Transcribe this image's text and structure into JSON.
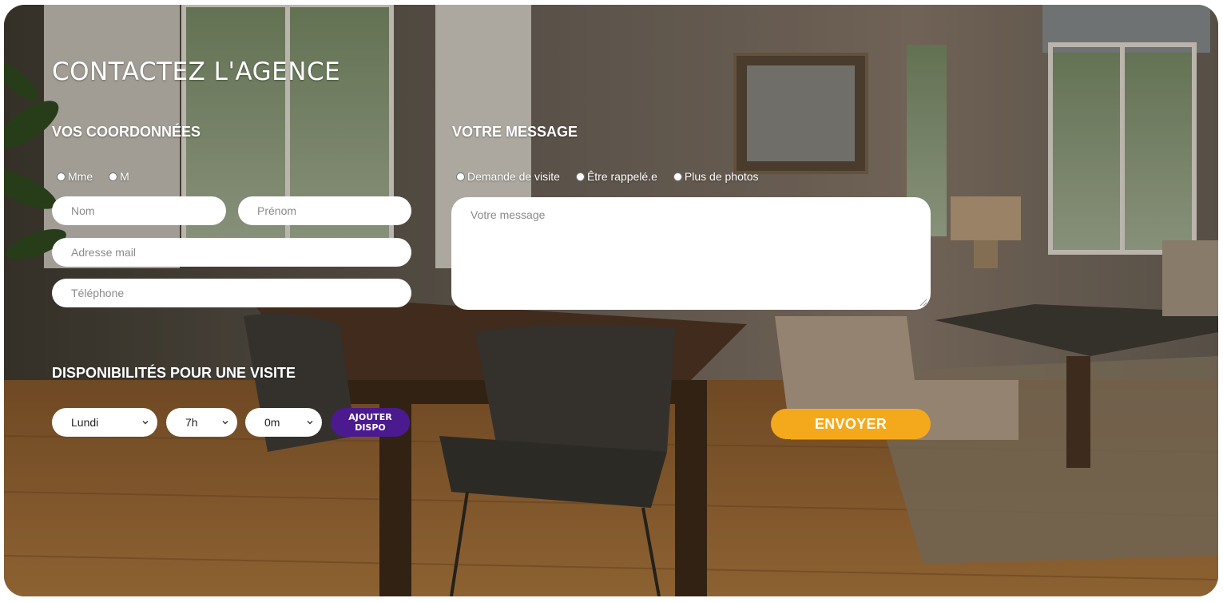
{
  "page": {
    "title": "CONTACTEZ L'AGENCE"
  },
  "coordonnees": {
    "heading": "VOS COORDONNÉES",
    "civility_options": [
      "Mme",
      "M"
    ],
    "nom_placeholder": "Nom",
    "prenom_placeholder": "Prénom",
    "email_placeholder": "Adresse mail",
    "phone_placeholder": "Téléphone"
  },
  "message": {
    "heading": "VOTRE MESSAGE",
    "type_options": [
      "Demande de visite",
      "Être rappelé.e",
      "Plus de photos"
    ],
    "message_placeholder": "Votre message"
  },
  "disponibilites": {
    "heading": "DISPONIBILITÉS POUR UNE VISITE",
    "day_value": "Lundi",
    "hour_value": "7h",
    "minute_value": "0m",
    "add_label_line1": "AJOUTER",
    "add_label_line2": "DISPO"
  },
  "actions": {
    "send_label": "ENVOYER"
  },
  "colors": {
    "accent_purple": "#4b1a8e",
    "accent_orange": "#f4a91c"
  }
}
